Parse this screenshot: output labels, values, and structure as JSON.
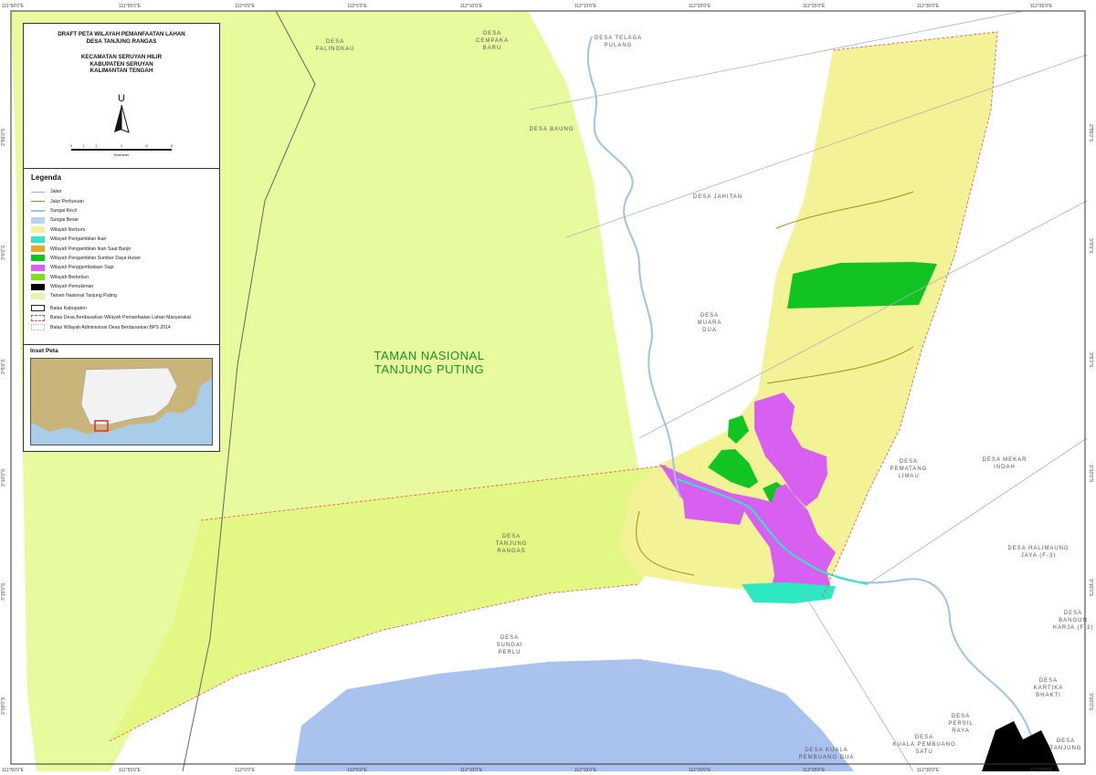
{
  "map": {
    "title_lines": [
      "DRAFT PETA WILAYAH PEMANFAATAN LAHAN",
      "DESA TANJUNG RANGAS"
    ],
    "subtitle_lines": [
      "KECAMATAN SERUYAN HILIR",
      "KABUPATEN SERUYAN",
      "KALIMANTAN TENGAH"
    ],
    "north_letter": "U",
    "scale_numbers": [
      "0",
      "1",
      "2",
      "4",
      "6",
      "8"
    ],
    "scale_unit": "Kilometer",
    "park_label_lines": [
      "TAMAN NASIONAL",
      "TANJUNG PUTING"
    ],
    "colors": {
      "park": "#e7fa9d",
      "hunting": "#f4f296",
      "fishing": "#2ee8c2",
      "fishing_flood": "#e0b020",
      "forest": "#12c422",
      "cattle": "#d760f0",
      "farm": "#7ce01c",
      "settlement": "#000000",
      "park_legend": "#e4f7a8",
      "river": "#9cc3ea",
      "sea": "#a9c2ee",
      "boundary_red": "#e85050",
      "road": "#999999",
      "trail": "#a0901a"
    }
  },
  "ticks": {
    "top": [
      "111°50'0\"E",
      "111°55'0\"E",
      "112°0'0\"E",
      "112°5'0\"E",
      "112°10'0\"E",
      "112°15'0\"E",
      "112°20'0\"E",
      "112°25'0\"E",
      "112°30'0\"E",
      "112°35'0\"E"
    ],
    "bottom": [
      "111°50'0\"E",
      "111°55'0\"E",
      "112°0'0\"E",
      "112°5'0\"E",
      "112°10'0\"E",
      "112°15'0\"E",
      "112°20'0\"E",
      "112°25'0\"E",
      "112°30'0\"E",
      "112°35'0\"E"
    ],
    "left": [
      "2°55'0\"S",
      "3°0'0\"S",
      "3°5'0\"S",
      "3°10'0\"S",
      "3°15'0\"S",
      "3°20'0\"S"
    ],
    "right": [
      "2°55'0\"S",
      "3°0'0\"S",
      "3°5'0\"S",
      "3°10'0\"S",
      "3°15'0\"S",
      "3°20'0\"S"
    ]
  },
  "places": {
    "palingkau": "DESA\nPALINGKAU",
    "cempaka": "DESA\nCEMPAKA\nBARU",
    "telaga": "DESA TELAGA\nPULANG",
    "baung": "DESA BAUNG",
    "jahitan": "DESA JAHITAN",
    "muara_dua": "DESA\nMUARA\nDUA",
    "pematang_limau": "DESA\nPEMATANG\nLIMAU",
    "mekar_indah": "DESA MEKAR\nINDAH",
    "tanjung_rangas": "DESA\nTANJUNG\nRANGAS",
    "halimaung": "DESA HALIMAUNG\nJAYA (F-3)",
    "bangun_harja": "DESA\nBANGUN\nHARJA (F-2)",
    "sungai_perlu": "DESA\nSUNGAI\nPERLU",
    "kartika": "DESA\nKARTIKA\nBHAKTI",
    "persil": "DESA\nPERSIL\nRAYA",
    "kuala_satu": "DESA\nKUALA PEMBUANG\nSATU",
    "kuala_dua": "DESA KUALA\nPEMBUANG DUA",
    "tanjung": "DESA\nTANJUNG"
  },
  "legend": {
    "heading": "Legenda",
    "items": [
      {
        "label": "Jalan",
        "kind": "line",
        "color": "#b0b0b0"
      },
      {
        "label": "Jalur Perburuan",
        "kind": "line",
        "color": "#a0901a"
      },
      {
        "label": "Sungai Kecil",
        "kind": "line",
        "color": "#9cc3ea"
      },
      {
        "label": "Sungai Besar",
        "kind": "fill",
        "color": "#b9d3f1"
      },
      {
        "label": "Wilayah Berburu",
        "kind": "fill",
        "color": "#f4f296"
      },
      {
        "label": "Wilayah Pengambilan Ikan",
        "kind": "fill",
        "color": "#2ee8c2"
      },
      {
        "label": "Wilayah Pengambilan Ikan Saat Banjir",
        "kind": "fill",
        "color": "#e0b020"
      },
      {
        "label": "Wilayah Pengambilan Sumber Daya Hutan",
        "kind": "fill",
        "color": "#12c422"
      },
      {
        "label": "Wilayah Penggembalaan Sapi",
        "kind": "fill",
        "color": "#d760f0"
      },
      {
        "label": "Wilayah Berkebun",
        "kind": "fill",
        "color": "#7ce01c"
      },
      {
        "label": "Wilayah Pemukiman",
        "kind": "fill",
        "color": "#000000"
      },
      {
        "label": "Taman Nasional Tanjung Puting",
        "kind": "fill",
        "color": "#e4f7a8"
      },
      {
        "label": "Batas Kabupaten",
        "kind": "outline",
        "color": "#222222"
      },
      {
        "label": "Batas Desa Berdasarkan Wilayah Pemanfaatan Lahan Masyarakat",
        "kind": "dashed",
        "color": "#e85050"
      },
      {
        "label": "Batas Wilayah Administrasi Desa Berdasarkan BPS 2014",
        "kind": "dotted",
        "color": "#c8a0a0"
      }
    ]
  },
  "inset": {
    "heading": "Inset Peta"
  }
}
